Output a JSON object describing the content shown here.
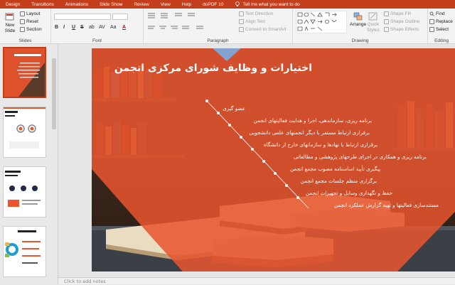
{
  "tabs": [
    "Design",
    "Transitions",
    "Animations",
    "Slide Show",
    "Review",
    "View",
    "Help",
    "doPDF 10"
  ],
  "tell_me": "Tell me what you want to do",
  "ribbon": {
    "slides": {
      "new_slide": "New",
      "new_slide2": "Slide",
      "layout": "Layout",
      "reset": "Reset",
      "section": "Section",
      "label": "Slides"
    },
    "font": {
      "format_buttons": [
        "B",
        "I",
        "U",
        "S",
        "ab",
        "AV",
        "Aa",
        "A"
      ],
      "label": "Font"
    },
    "paragraph": {
      "text_direction": "Text Direction",
      "align_text": "Align Text",
      "convert_smartart": "Convert to SmartArt",
      "label": "Paragraph"
    },
    "drawing": {
      "arrange": "Arrange",
      "quick_styles": "Quick",
      "quick_styles2": "Styles",
      "shape_fill": "Shape Fill",
      "shape_outline": "Shape Outline",
      "shape_effects": "Shape Effects",
      "label": "Drawing"
    },
    "editing": {
      "find": "Find",
      "replace": "Replace",
      "select": "Select",
      "label": "Editing"
    }
  },
  "slide": {
    "title": "اختیارات و وظایف شورای مرکزی انجمن",
    "items": [
      "عضو گیری",
      "برنامه ریزی، سازماندهی، اجرا و هدایت فعالیتهای انجمن",
      "برقراری ارتباط مستمر با دیگر انجمنهای علمی دانشجویی",
      "برقراری ارتباط با نهادها و سازمانهای خارج از دانشگاه",
      "برنامه ریزی و همکاری در اجرای طرحهای پژوهشی و مطالعاتی",
      "پیگیری تأیید اساسنامه مصوب مجمع انجمن",
      "برگزاری منظم جلسات مجمع انجمن",
      "حفظ و نگهداری وسایل و تجهیزات انجمن",
      "مستندسازی فعالیتها و تهیه گزارش عملکرد انجمن"
    ],
    "accent_color": "#e8552e"
  },
  "thumbnails": [
    {
      "title": "اختیارات و وظایف شورای مرکزی انجمن",
      "active": true
    },
    {
      "title": "بخش سوم: اساسنامه",
      "active": false
    },
    {
      "title": "اعضاء مجمع و وظایف اساسنامه",
      "active": false
    },
    {
      "title": "بخش چهارم",
      "active": false
    }
  ],
  "notes_placeholder": "Click to add notes"
}
